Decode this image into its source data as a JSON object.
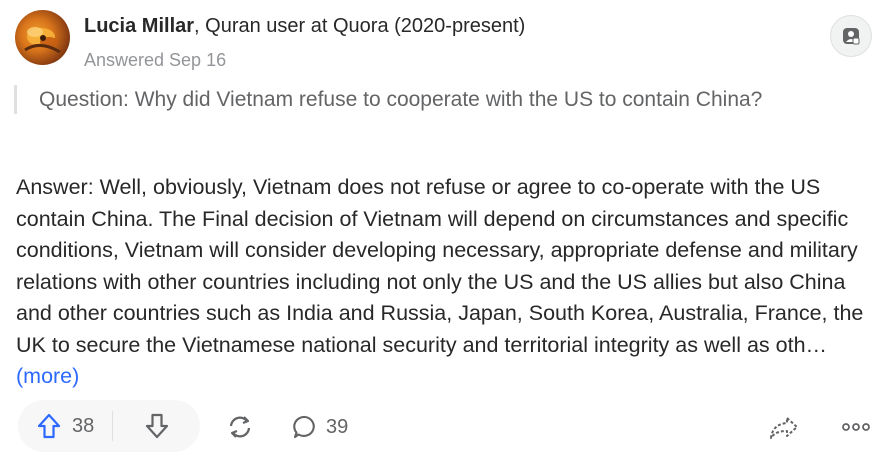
{
  "author": {
    "name": "Lucia Millar",
    "credential": ", Quran user at Quora (2020-present)",
    "answered": "Answered Sep 16"
  },
  "question": {
    "text": "Question: Why did Vietnam refuse to cooperate with the US to contain China?"
  },
  "answer": {
    "text": "Answer: Well, obviously, Vietnam does not refuse or agree to co-operate with the US contain China. The Final decision of Vietnam will depend on circumstances and specific conditions, Vietnam will consider developing necessary, appropriate defense and military relations with other countries including not only the US and the US allies but also China and other countries such as India and Russia, Japan, South Korea, Australia, France, the UK to secure the Vietnamese national security and territorial integrity as well as oth…",
    "more_label": " (more)"
  },
  "actions": {
    "upvote_count": "38",
    "comment_count": "39"
  },
  "icons": {
    "profile": "user-badge-icon",
    "upvote": "arrow-up-icon",
    "downvote": "arrow-down-icon",
    "share": "reshare-icon",
    "comment": "comment-icon",
    "forward": "forward-icon",
    "more": "more-icon"
  },
  "colors": {
    "link": "#2e69ff",
    "upvote": "#2e69ff",
    "muted": "#939598"
  }
}
